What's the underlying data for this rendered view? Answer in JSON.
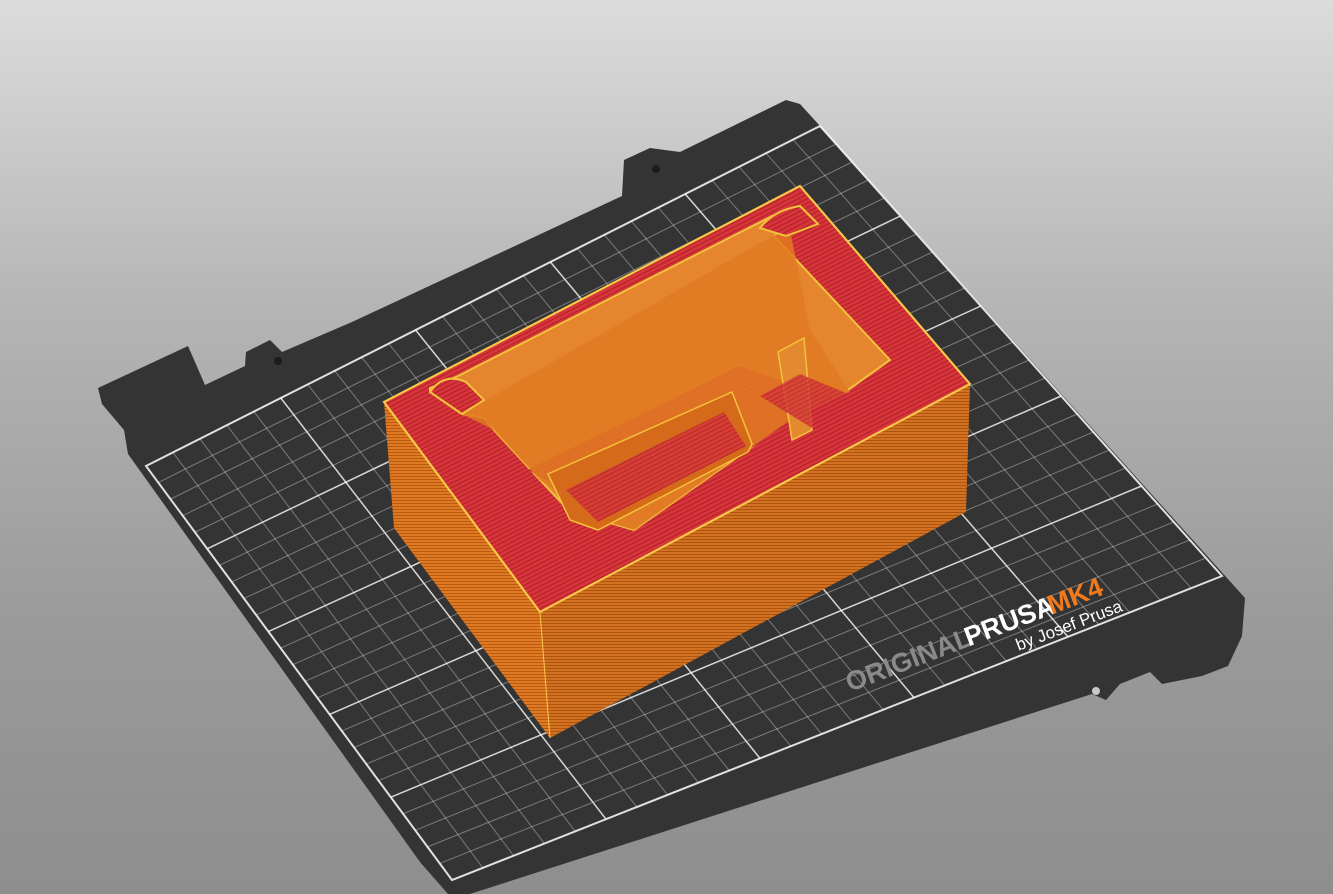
{
  "viewport": {
    "background_top": "#dcdcdc",
    "background_bottom": "#8e8e8e"
  },
  "print_bed": {
    "plate_color": "#343434",
    "grid_color": "#ffffff",
    "logo": {
      "original": "ORIGINAL",
      "prusa": "PRUSA",
      "model": "MK4",
      "byline": "by Josef Prusa",
      "original_color": "#8a8a8a",
      "prusa_color": "#ffffff",
      "model_color": "#f07a1e",
      "byline_color": "#ffffff"
    }
  },
  "model": {
    "wall_color": "#e07a22",
    "top_color": "#d9343a",
    "perimeter_color": "#f2c33a"
  }
}
